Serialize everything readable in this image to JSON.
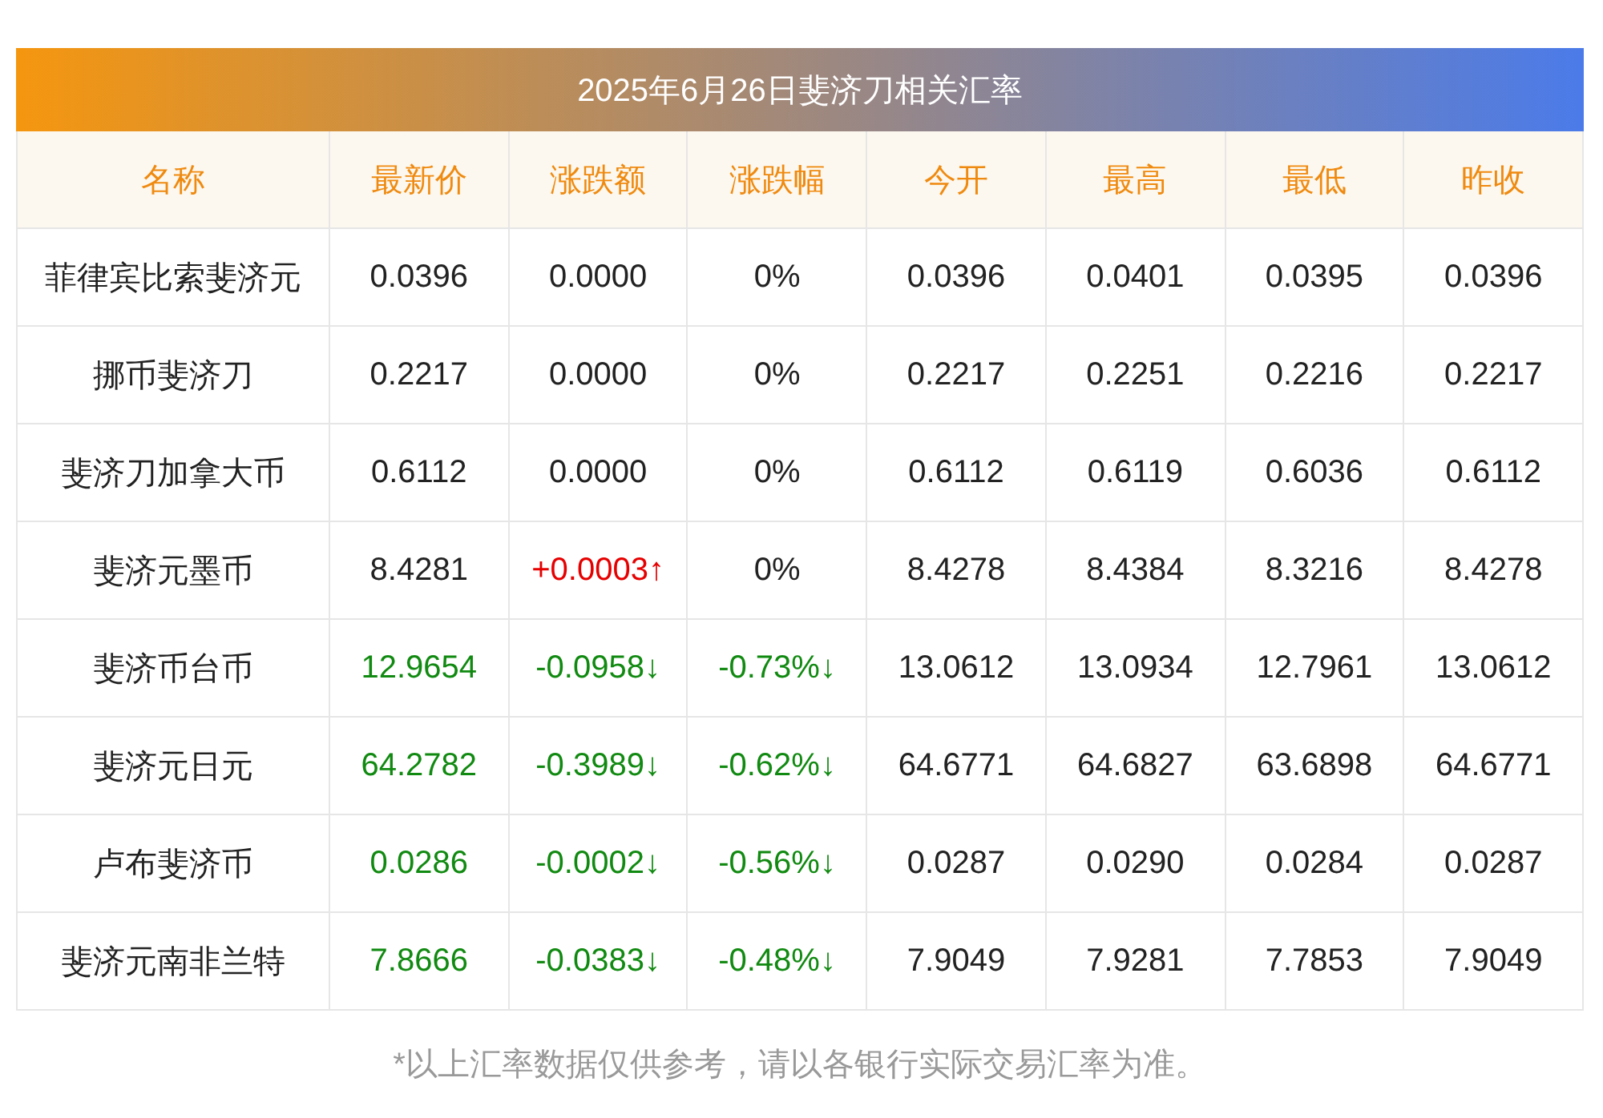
{
  "title": "2025年6月26日斐济刀相关汇率",
  "columns": [
    "名称",
    "最新价",
    "涨跌额",
    "涨跌幅",
    "今开",
    "最高",
    "最低",
    "昨收"
  ],
  "rows": [
    {
      "name": "菲律宾比索斐济元",
      "price": {
        "text": "0.0396",
        "kind": "flat"
      },
      "change": {
        "text": "0.0000",
        "kind": "flat"
      },
      "pct": {
        "text": "0%",
        "kind": "flat"
      },
      "open": "0.0396",
      "high": "0.0401",
      "low": "0.0395",
      "prev_close": "0.0396"
    },
    {
      "name": "挪币斐济刀",
      "price": {
        "text": "0.2217",
        "kind": "flat"
      },
      "change": {
        "text": "0.0000",
        "kind": "flat"
      },
      "pct": {
        "text": "0%",
        "kind": "flat"
      },
      "open": "0.2217",
      "high": "0.2251",
      "low": "0.2216",
      "prev_close": "0.2217"
    },
    {
      "name": "斐济刀加拿大币",
      "price": {
        "text": "0.6112",
        "kind": "flat"
      },
      "change": {
        "text": "0.0000",
        "kind": "flat"
      },
      "pct": {
        "text": "0%",
        "kind": "flat"
      },
      "open": "0.6112",
      "high": "0.6119",
      "low": "0.6036",
      "prev_close": "0.6112"
    },
    {
      "name": "斐济元墨币",
      "price": {
        "text": "8.4281",
        "kind": "flat"
      },
      "change": {
        "text": "+0.0003↑",
        "kind": "up"
      },
      "pct": {
        "text": "0%",
        "kind": "flat"
      },
      "open": "8.4278",
      "high": "8.4384",
      "low": "8.3216",
      "prev_close": "8.4278"
    },
    {
      "name": "斐济币台币",
      "price": {
        "text": "12.9654",
        "kind": "down"
      },
      "change": {
        "text": "-0.0958↓",
        "kind": "down"
      },
      "pct": {
        "text": "-0.73%↓",
        "kind": "down"
      },
      "open": "13.0612",
      "high": "13.0934",
      "low": "12.7961",
      "prev_close": "13.0612"
    },
    {
      "name": "斐济元日元",
      "price": {
        "text": "64.2782",
        "kind": "down"
      },
      "change": {
        "text": "-0.3989↓",
        "kind": "down"
      },
      "pct": {
        "text": "-0.62%↓",
        "kind": "down"
      },
      "open": "64.6771",
      "high": "64.6827",
      "low": "63.6898",
      "prev_close": "64.6771"
    },
    {
      "name": "卢布斐济币",
      "price": {
        "text": "0.0286",
        "kind": "down"
      },
      "change": {
        "text": "-0.0002↓",
        "kind": "down"
      },
      "pct": {
        "text": "-0.56%↓",
        "kind": "down"
      },
      "open": "0.0287",
      "high": "0.0290",
      "low": "0.0284",
      "prev_close": "0.0287"
    },
    {
      "name": "斐济元南非兰特",
      "price": {
        "text": "7.8666",
        "kind": "down"
      },
      "change": {
        "text": "-0.0383↓",
        "kind": "down"
      },
      "pct": {
        "text": "-0.48%↓",
        "kind": "down"
      },
      "open": "7.9049",
      "high": "7.9281",
      "low": "7.7853",
      "prev_close": "7.9049"
    }
  ],
  "footnote": "*以上汇率数据仅供参考，请以各银行实际交易汇率为准。"
}
